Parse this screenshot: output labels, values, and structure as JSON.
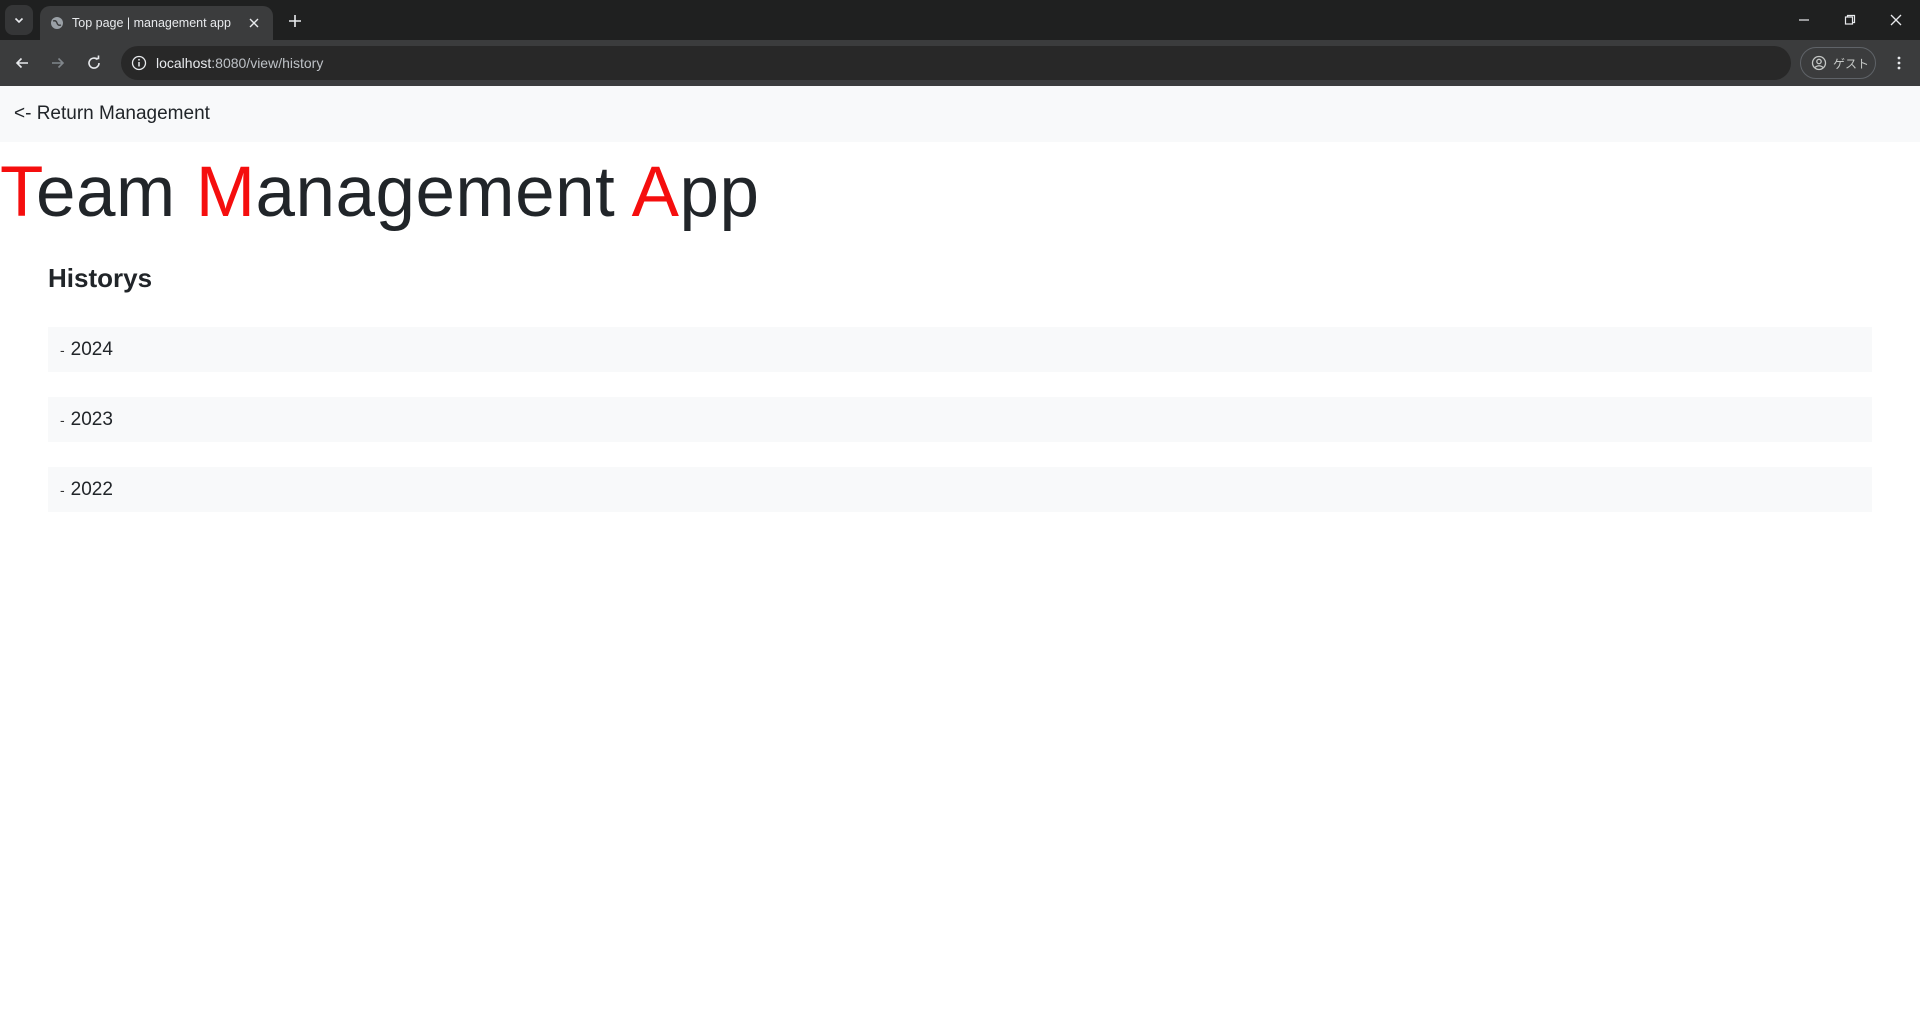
{
  "browser": {
    "tab_title": "Top page | management app",
    "url_host": "localhost",
    "url_rest": ":8080/view/history",
    "profile_label": "ゲスト"
  },
  "nav": {
    "return_label": "<- Return Management"
  },
  "title": {
    "parts": [
      {
        "text": "T",
        "accent": true
      },
      {
        "text": "eam ",
        "accent": false
      },
      {
        "text": "M",
        "accent": true
      },
      {
        "text": "anagement ",
        "accent": false
      },
      {
        "text": "A",
        "accent": true
      },
      {
        "text": "pp",
        "accent": false
      }
    ]
  },
  "section": {
    "heading": "Historys"
  },
  "history": {
    "items": [
      {
        "dash": "-",
        "year": "2024"
      },
      {
        "dash": "-",
        "year": "2023"
      },
      {
        "dash": "-",
        "year": "2022"
      }
    ]
  },
  "colors": {
    "accent": "#f50e0e",
    "text": "#212529",
    "panel": "#f8f9fa"
  }
}
